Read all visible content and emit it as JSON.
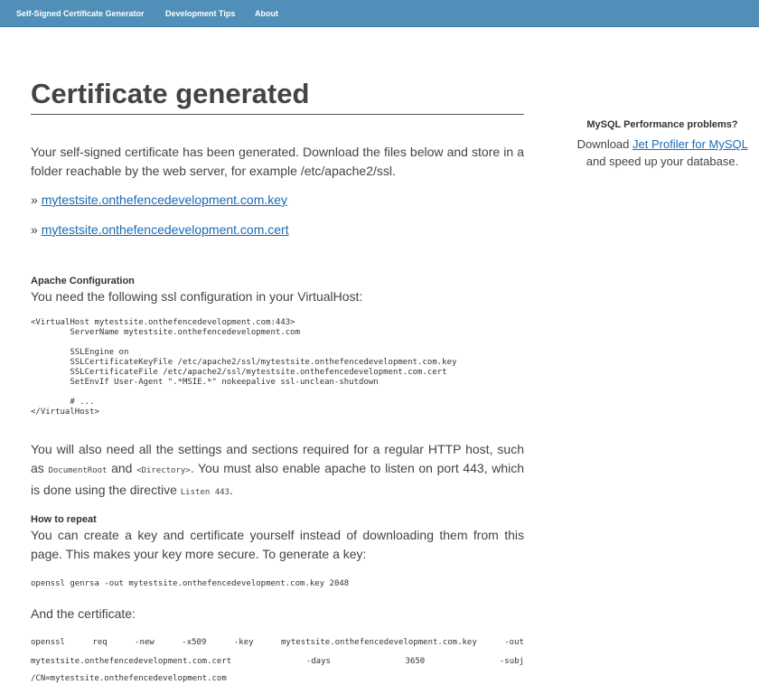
{
  "nav": {
    "items": [
      {
        "label": "Self-Signed Certificate Generator"
      },
      {
        "label": "Development Tips"
      },
      {
        "label": "About"
      }
    ]
  },
  "main": {
    "title": "Certificate generated",
    "intro": "Your self-signed certificate has been generated. Download the files below and store in a folder reachable by the web server, for example /etc/apache2/ssl.",
    "downloads": [
      {
        "prefix": "»",
        "label": "mytestsite.onthefencedevelopment.com.key"
      },
      {
        "prefix": "»",
        "label": "mytestsite.onthefencedevelopment.com.cert"
      }
    ],
    "apache": {
      "heading": "Apache Configuration",
      "intro": "You need the following ssl configuration in your VirtualHost:",
      "config": "<VirtualHost mytestsite.onthefencedevelopment.com:443>\n        ServerName mytestsite.onthefencedevelopment.com\n\n        SSLEngine on\n        SSLCertificateKeyFile /etc/apache2/ssl/mytestsite.onthefencedevelopment.com.key\n        SSLCertificateFile /etc/apache2/ssl/mytestsite.onthefencedevelopment.com.cert\n        SetEnvIf User-Agent \".*MSIE.*\" nokeepalive ssl-unclean-shutdown\n\n        # ...\n</VirtualHost>",
      "note_part1": "You will also need all the settings and sections required for a regular HTTP host, such as",
      "note_code1": "DocumentRoot",
      "note_and": "and",
      "note_code2": "<Directory>",
      "note_part2": ". You must also enable apache to listen on port 443, which is done using the directive",
      "note_code3": "Listen 443",
      "note_end": "."
    },
    "repeat": {
      "heading": "How to repeat",
      "intro": "You can create a key and certificate yourself instead of downloading them from this page. This makes your key more secure. To generate a key:",
      "key_command": "openssl genrsa -out mytestsite.onthefencedevelopment.com.key 2048",
      "cert_label": "And the certificate:",
      "cert_line1": [
        "openssl",
        "req",
        "-new",
        "-x509",
        "-key",
        "mytestsite.onthefencedevelopment.com.key",
        "-out"
      ],
      "cert_line2": [
        "mytestsite.onthefencedevelopment.com.cert",
        "-days",
        "3650",
        "-subj"
      ],
      "cert_line3": "/CN=mytestsite.onthefencedevelopment.com"
    }
  },
  "sidebar": {
    "title": "MySQL Performance problems?",
    "text_before": "Download",
    "link": "Jet Profiler for MySQL",
    "text_after": "and speed up your database."
  }
}
